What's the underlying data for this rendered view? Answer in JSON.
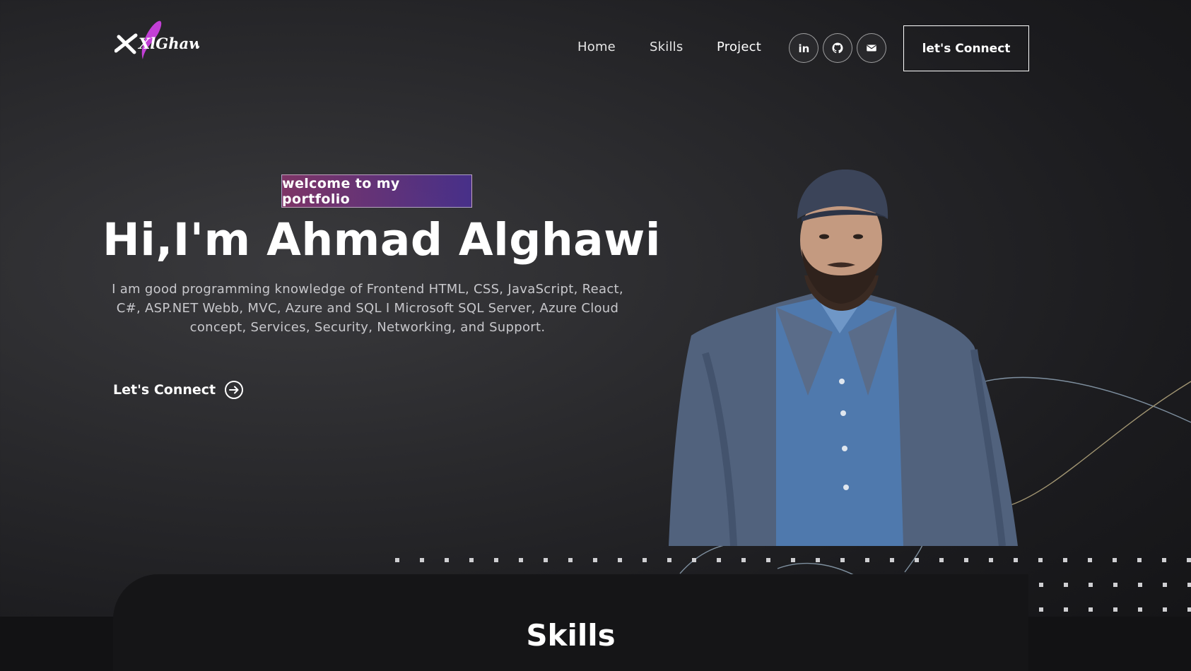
{
  "brand": {
    "logo_text": "XlGhawi",
    "accent_color": "#c23fd6"
  },
  "nav": {
    "links": [
      "Home",
      "Skills",
      "Project"
    ],
    "social_icons": [
      "linkedin-icon",
      "github-icon",
      "mail-icon"
    ],
    "connect_label": "let's Connect"
  },
  "hero": {
    "tagline": "welcome to my portfolio",
    "title": "Hi,I'm Ahmad Alghawi",
    "description": "I am good programming knowledge of Frontend HTML, CSS, JavaScript, React, C#, ASP.NET Webb, MVC, Azure and SQL I Microsoft SQL Server, Azure Cloud concept, Services, Security, Networking, and Support.",
    "cta_label": "Let's Connect",
    "cta_icon": "arrow-right-circle-icon",
    "tagline_gradient": [
      "#aa367c",
      "#4a2fbd"
    ]
  },
  "skills": {
    "title": "Skills"
  }
}
